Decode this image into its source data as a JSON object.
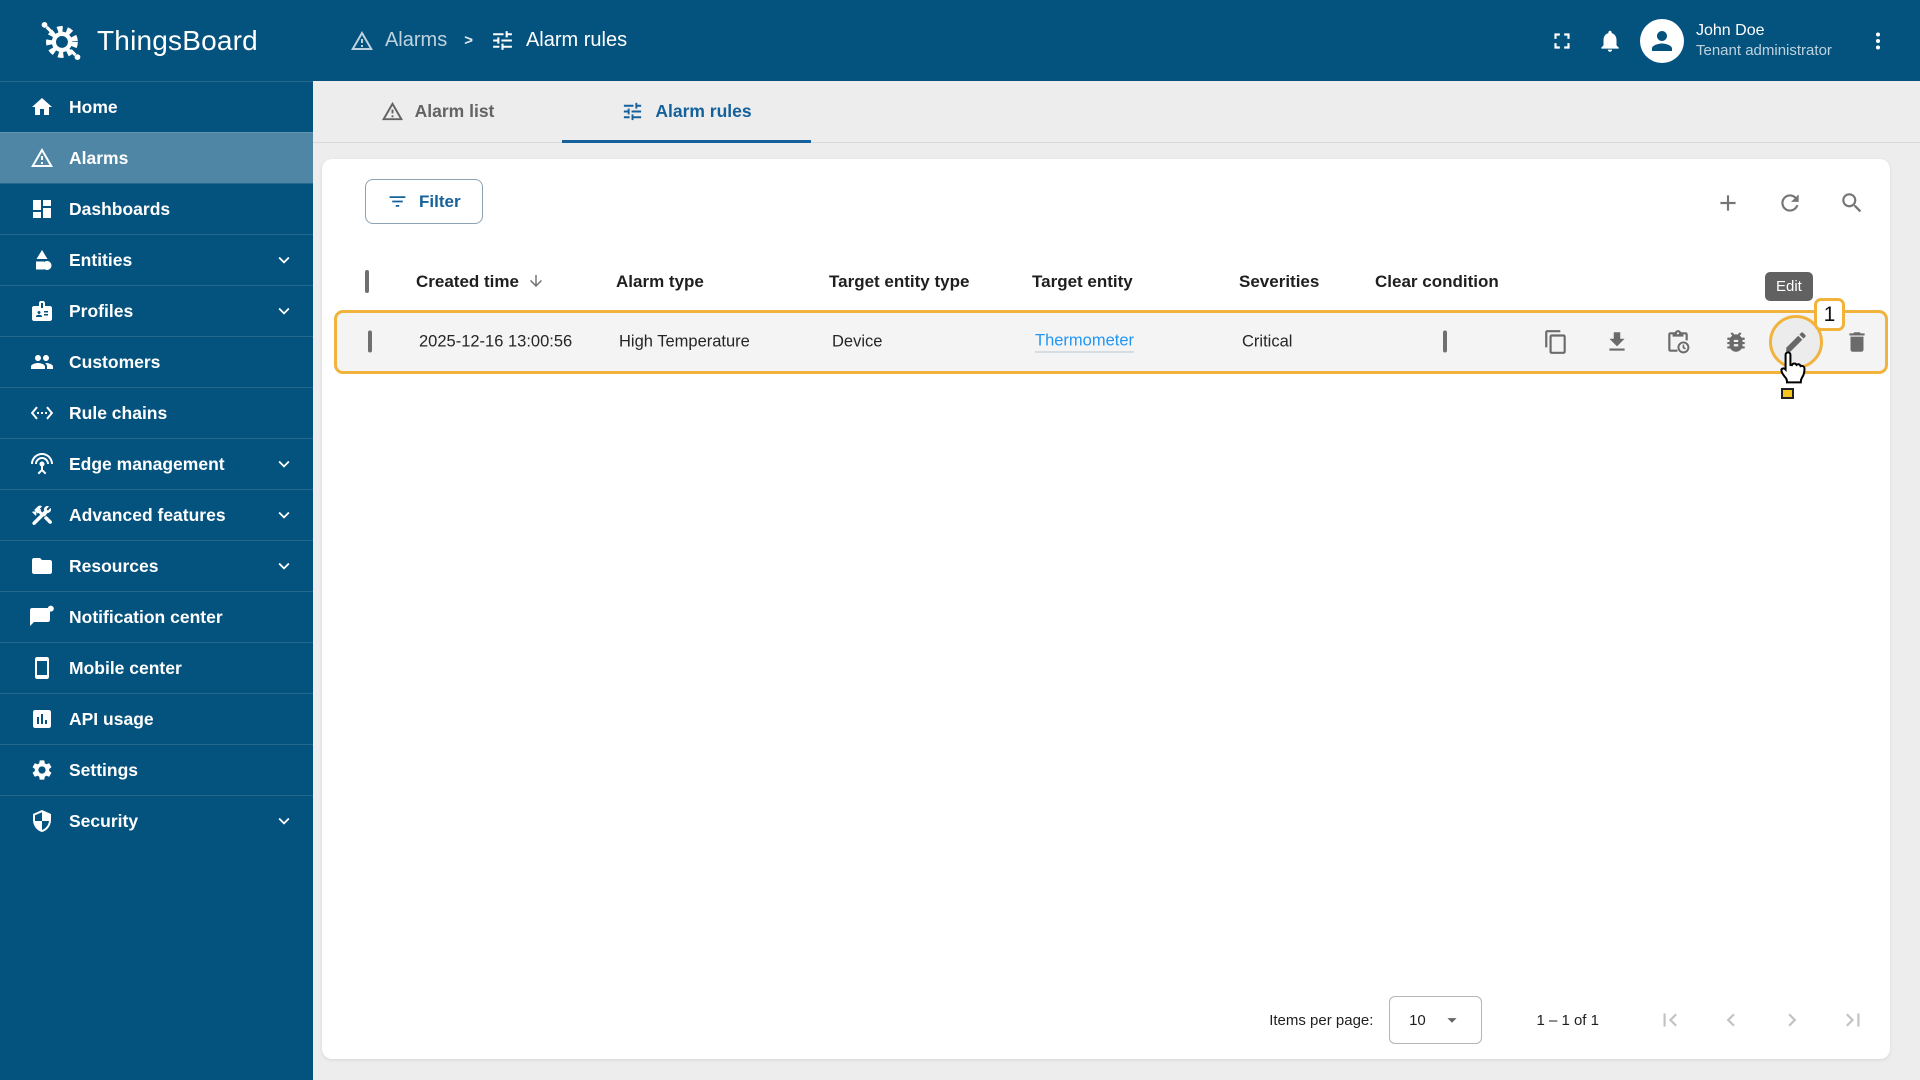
{
  "colors": {
    "primary_blue": "#04527e",
    "active_item_overlay": "rgba(255,255,255,0.3)",
    "tab_active_blue": "#14619b",
    "link_blue": "#2196f3",
    "highlight_yellow": "#f2b33d",
    "tooltip_grey": "#616161"
  },
  "app": {
    "name": "ThingsBoard"
  },
  "breadcrumb": {
    "separator": ">",
    "items": [
      {
        "label": "Alarms",
        "icon": "warning-icon"
      },
      {
        "label": "Alarm rules",
        "icon": "tune-icon"
      }
    ]
  },
  "user": {
    "name": "John Doe",
    "role": "Tenant administrator"
  },
  "sidebar": {
    "items": [
      {
        "label": "Home",
        "icon": "home-icon",
        "active": false,
        "expandable": false
      },
      {
        "label": "Alarms",
        "icon": "warning-icon",
        "active": true,
        "expandable": false
      },
      {
        "label": "Dashboards",
        "icon": "dashboards-icon",
        "active": false,
        "expandable": false
      },
      {
        "label": "Entities",
        "icon": "entities-icon",
        "active": false,
        "expandable": true
      },
      {
        "label": "Profiles",
        "icon": "profiles-icon",
        "active": false,
        "expandable": true
      },
      {
        "label": "Customers",
        "icon": "customers-icon",
        "active": false,
        "expandable": false
      },
      {
        "label": "Rule chains",
        "icon": "rule-chains-icon",
        "active": false,
        "expandable": false
      },
      {
        "label": "Edge management",
        "icon": "edge-icon",
        "active": false,
        "expandable": true
      },
      {
        "label": "Advanced features",
        "icon": "advanced-features-icon",
        "active": false,
        "expandable": true
      },
      {
        "label": "Resources",
        "icon": "resources-icon",
        "active": false,
        "expandable": true
      },
      {
        "label": "Notification center",
        "icon": "notification-icon",
        "active": false,
        "expandable": false
      },
      {
        "label": "Mobile center",
        "icon": "mobile-icon",
        "active": false,
        "expandable": false
      },
      {
        "label": "API usage",
        "icon": "api-usage-icon",
        "active": false,
        "expandable": false
      },
      {
        "label": "Settings",
        "icon": "settings-icon",
        "active": false,
        "expandable": false
      },
      {
        "label": "Security",
        "icon": "security-icon",
        "active": false,
        "expandable": true
      }
    ]
  },
  "tabs": [
    {
      "label": "Alarm list",
      "icon": "warning-icon",
      "active": false
    },
    {
      "label": "Alarm rules",
      "icon": "tune-icon",
      "active": true
    }
  ],
  "toolbar": {
    "filter_label": "Filter",
    "actions": [
      "add",
      "refresh",
      "search"
    ]
  },
  "table": {
    "columns": {
      "created_time": "Created time",
      "alarm_type": "Alarm type",
      "target_entity_type": "Target entity type",
      "target_entity": "Target entity",
      "severities": "Severities",
      "clear_condition": "Clear condition"
    },
    "rows": [
      {
        "created_time": "2025-12-16 13:00:56",
        "alarm_type": "High Temperature",
        "target_entity_type": "Device",
        "target_entity": "Thermometer",
        "severities": "Critical",
        "row_actions": [
          "copy",
          "export",
          "schedule",
          "debug",
          "edit",
          "delete"
        ]
      }
    ]
  },
  "annotation": {
    "tooltip_label": "Edit",
    "step_badge": "1"
  },
  "pagination": {
    "items_per_page_label": "Items per page:",
    "page_size": "10",
    "range_label": "1 – 1 of 1"
  }
}
